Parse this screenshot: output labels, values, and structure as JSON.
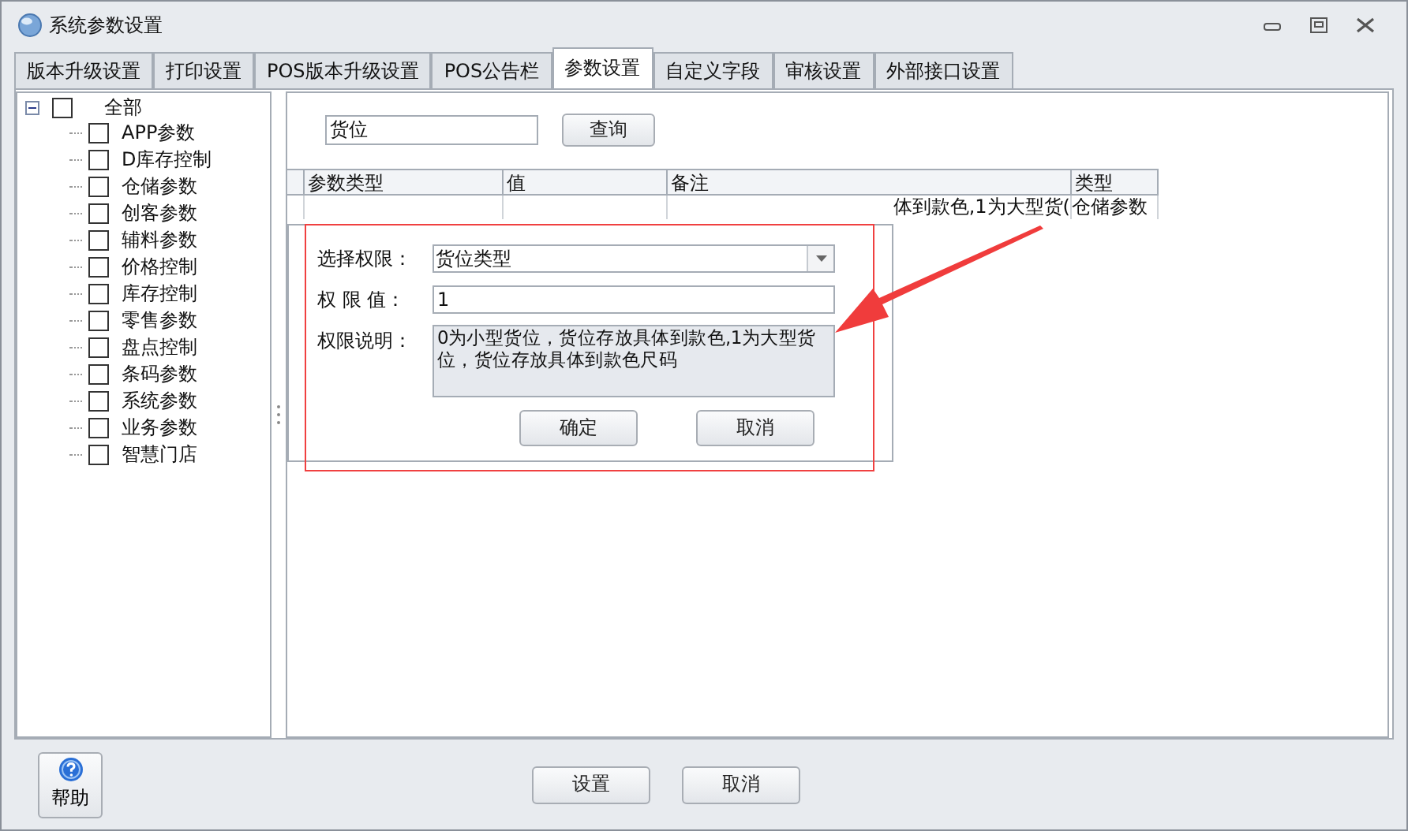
{
  "window": {
    "title": "系统参数设置"
  },
  "tabs": [
    {
      "label": "版本升级设置",
      "selected": false
    },
    {
      "label": "打印设置",
      "selected": false
    },
    {
      "label": "POS版本升级设置",
      "selected": false
    },
    {
      "label": "POS公告栏",
      "selected": false
    },
    {
      "label": "参数设置",
      "selected": true
    },
    {
      "label": "自定义字段",
      "selected": false
    },
    {
      "label": "审核设置",
      "selected": false
    },
    {
      "label": "外部接口设置",
      "selected": false
    }
  ],
  "tree": {
    "label": "全部",
    "checked": false,
    "expanded": true,
    "children": [
      {
        "label": "APP参数",
        "checked": false
      },
      {
        "label": "D库存控制",
        "checked": false
      },
      {
        "label": "仓储参数",
        "checked": false
      },
      {
        "label": "创客参数",
        "checked": false
      },
      {
        "label": "辅料参数",
        "checked": false
      },
      {
        "label": "价格控制",
        "checked": false
      },
      {
        "label": "库存控制",
        "checked": false
      },
      {
        "label": "零售参数",
        "checked": false
      },
      {
        "label": "盘点控制",
        "checked": false
      },
      {
        "label": "条码参数",
        "checked": false
      },
      {
        "label": "系统参数",
        "checked": false
      },
      {
        "label": "业务参数",
        "checked": false
      },
      {
        "label": "智慧门店",
        "checked": false
      }
    ]
  },
  "search": {
    "value": "货位",
    "button": "查询"
  },
  "table": {
    "columns": [
      "参数类型",
      "值",
      "备注",
      "类型"
    ],
    "rows": [
      {
        "remark": "体到款色,1为大型货(",
        "type": "仓储参数"
      }
    ]
  },
  "dialog": {
    "fields": [
      {
        "kind": "select",
        "label": "选择权限：",
        "value": "货位类型"
      },
      {
        "kind": "input",
        "label": "权 限 值：",
        "value": "1"
      },
      {
        "kind": "textarea",
        "label": "权限说明：",
        "value": "0为小型货位，货位存放具体到款色,1为大型货位，货位存放具体到款色尺码"
      }
    ],
    "buttons": [
      "确定",
      "取消"
    ]
  },
  "footer": {
    "help": "帮助",
    "buttons": [
      "设置",
      "取消"
    ]
  }
}
